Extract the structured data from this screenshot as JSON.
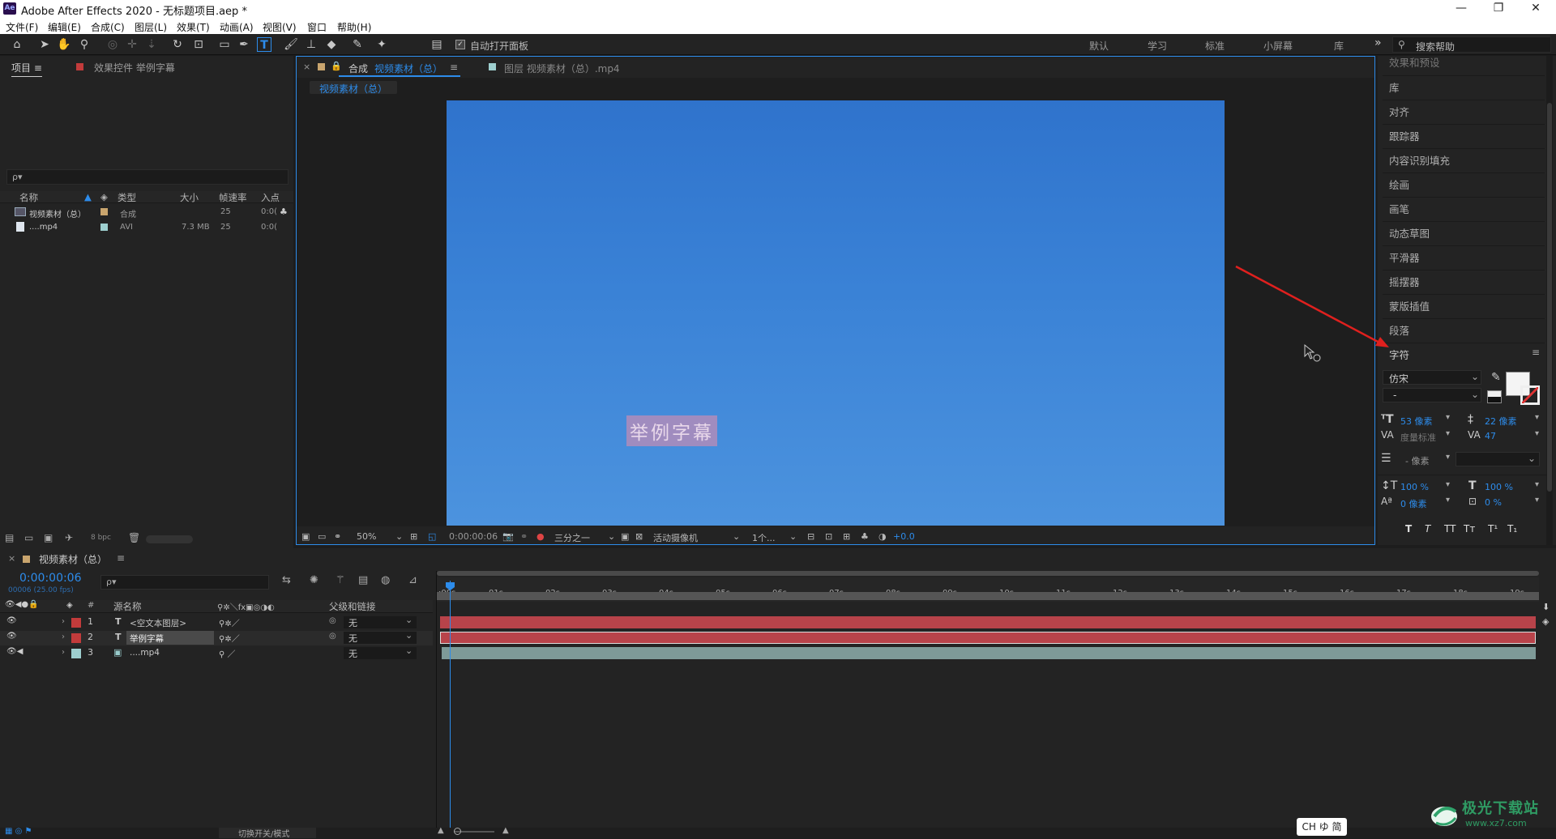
{
  "window": {
    "title": "Adobe After Effects 2020 - 无标题项目.aep *",
    "logo": "Ae",
    "minimize": "—",
    "maximize": "❐",
    "close": "✕"
  },
  "menu": [
    "文件(F)",
    "编辑(E)",
    "合成(C)",
    "图层(L)",
    "效果(T)",
    "动画(A)",
    "视图(V)",
    "窗口",
    "帮助(H)"
  ],
  "toolbar": {
    "auto_open_label": "自动打开面板",
    "workspaces": [
      "默认",
      "学习",
      "标准",
      "小屏幕",
      "库"
    ],
    "more": "»",
    "search_placeholder": "搜索帮助"
  },
  "project_panel": {
    "tab_project": "项目",
    "tab_effects": "效果控件 举例字幕",
    "search_placeholder": "ρ▾",
    "columns": [
      "名称",
      "类型",
      "大小",
      "帧速率",
      "入点"
    ],
    "items": [
      {
        "name": "视频素材（总）",
        "type": "合成",
        "size": "",
        "fps": "25",
        "in": "0:0("
      },
      {
        "name": "....mp4",
        "type": "AVI",
        "size": "7.3 MB",
        "fps": "25",
        "in": "0:0("
      }
    ],
    "bpc": "8 bpc"
  },
  "comp_panel": {
    "tab_prefix": "合成",
    "tab_name": "视频素材（总）",
    "tab_layer": "图层 视频素材（总）.mp4",
    "breadcrumb": "视频素材（总）",
    "subtitle_text": "举例字幕",
    "zoom": "50%",
    "time": "0:00:00:06",
    "resolution": "三分之一",
    "camera": "活动摄像机",
    "views": "1个...",
    "exposure": "+0.0"
  },
  "right_panel": {
    "items": [
      "效果和预设",
      "库",
      "对齐",
      "跟踪器",
      "内容识别填充",
      "绘画",
      "画笔",
      "动态草图",
      "平滑器",
      "摇摆器",
      "蒙版插值",
      "段落"
    ],
    "character": {
      "title": "字符",
      "font": "仿宋",
      "style": "-",
      "size": "53 像素",
      "leading": "22 像素",
      "kerning": "度量标准",
      "tracking": "47",
      "stroke": "- 像素",
      "vscale": "100 %",
      "hscale": "100 %",
      "baseline": "0 像素",
      "tsume": "0 %",
      "styles": [
        "T",
        "T",
        "TT",
        "Tт",
        "T¹",
        "T₁"
      ]
    }
  },
  "timeline": {
    "tab_name": "视频素材（总）",
    "timecode": "0:00:00:06",
    "frame_info": "00006 (25.00 fps)",
    "col_source": "源名称",
    "col_parent": "父级和链接",
    "layers": [
      {
        "num": "1",
        "type": "T",
        "name": "<空文本图层>",
        "parent": "无",
        "color": "#c23b3b"
      },
      {
        "num": "2",
        "type": "T",
        "name": "举例字幕",
        "parent": "无",
        "color": "#c23b3b"
      },
      {
        "num": "3",
        "type": "▣",
        "name": "....mp4",
        "parent": "无",
        "color": "#9ecfcf"
      }
    ],
    "ticks": [
      ":00s",
      "01s",
      "02s",
      "03s",
      "04s",
      "05s",
      "06s",
      "07s",
      "08s",
      "09s",
      "10s",
      "11s",
      "12s",
      "13s",
      "14s",
      "15s",
      "16s",
      "17s",
      "18s",
      "19s"
    ],
    "switch_mode": "切换开关/模式"
  },
  "ime": "CH ゆ 简",
  "watermark": {
    "name": "极光下载站",
    "url": "www.xz7.com"
  },
  "colors": {
    "accent": "#2d8ceb",
    "layer_red": "#b8434a",
    "layer_teal": "#7e9a98",
    "arrow": "#e0201e"
  }
}
